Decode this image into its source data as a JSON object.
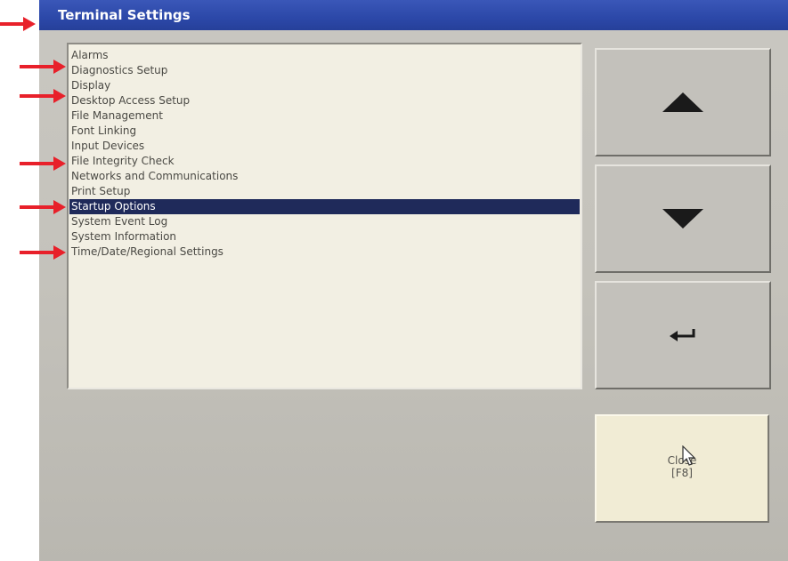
{
  "window": {
    "title": "Terminal Settings"
  },
  "settings_list": {
    "items": [
      "Alarms",
      "Diagnostics Setup",
      "Display",
      "Desktop Access Setup",
      "File Management",
      "Font Linking",
      "Input Devices",
      "File Integrity Check",
      "Networks and Communications",
      "Print Setup",
      "Startup Options",
      "System Event Log",
      "System Information",
      "Time/Date/Regional Settings"
    ],
    "selected_index": 10
  },
  "buttons": {
    "up_icon": "up-triangle-icon",
    "down_icon": "down-triangle-icon",
    "enter_icon": "enter-arrow-icon",
    "close_label_line1": "Close",
    "close_label_line2": "[F8]"
  },
  "colors": {
    "title_bar": "#2c48a8",
    "selection": "#1f2a5a",
    "annotation_arrow": "#e8202a"
  }
}
